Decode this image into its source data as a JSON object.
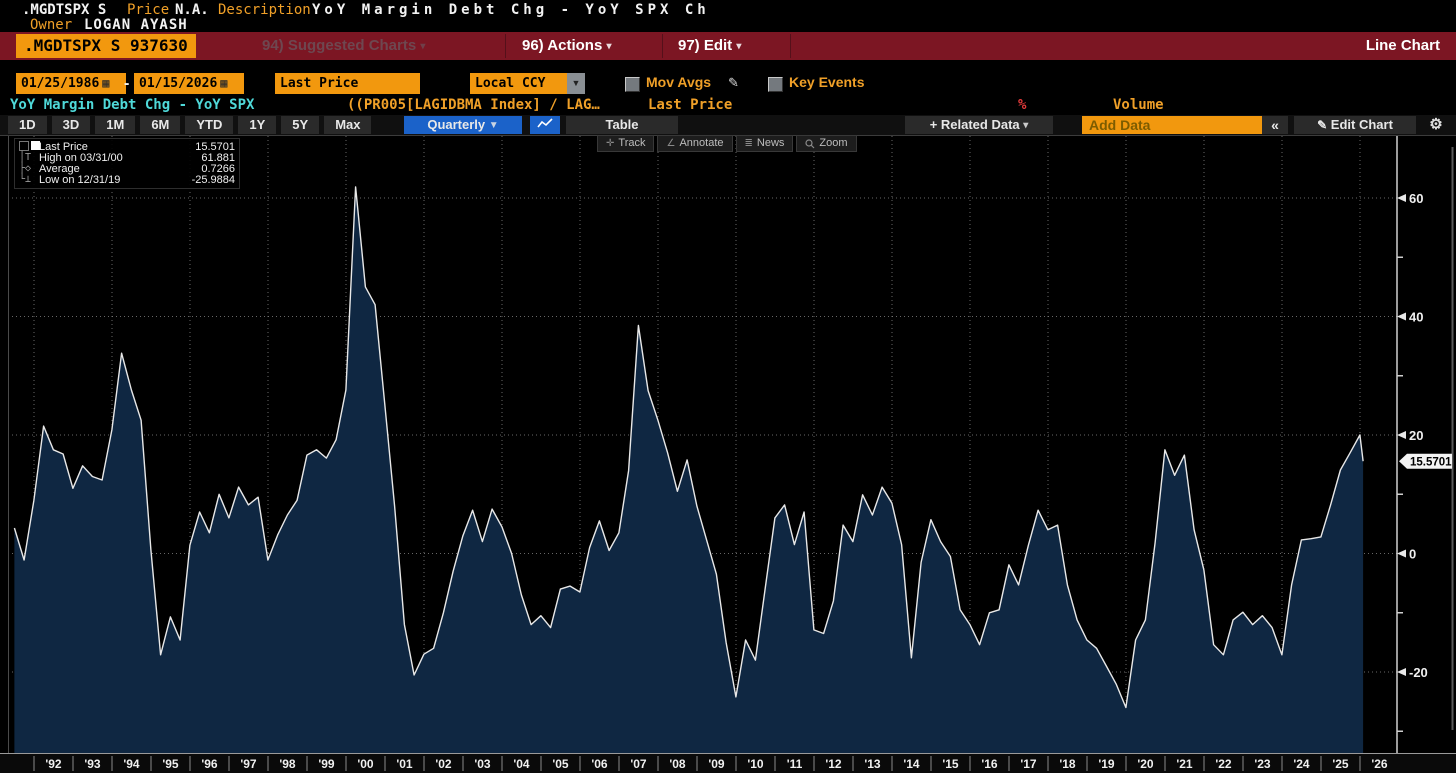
{
  "titlebar": {
    "ticker": ".MGDTSPX S",
    "price_label": "Price",
    "price_value": "N.A.",
    "description_label": "Description",
    "description_value": "YoY Margin Debt Chg - YoY SPX Ch",
    "owner_label": "Owner",
    "owner_value": "LOGAN AYASH"
  },
  "ribbon": {
    "security": ".MGDTSPX S 937630",
    "suggested_charts": "94) Suggested Charts",
    "actions": "96) Actions",
    "edit": "97) Edit",
    "mode": "Line Chart"
  },
  "controls": {
    "date_from": "01/25/1986",
    "date_separator": "-",
    "date_to": "01/15/2026",
    "field": "Last Price",
    "currency": "Local CCY",
    "mov_avgs": "Mov Avgs",
    "key_events": "Key Events"
  },
  "subtitle": {
    "series_name": "YoY Margin Debt Chg - YoY SPX",
    "formula": "((PR005[LAGIDBMA Index] / LAG…",
    "field": "Last Price",
    "percent": "%",
    "volume": "Volume"
  },
  "toolbar": {
    "ranges": [
      "1D",
      "3D",
      "1M",
      "6M",
      "YTD",
      "1Y",
      "5Y",
      "Max"
    ],
    "period": "Quarterly",
    "table": "Table",
    "related_data": "+ Related Data",
    "add_data_placeholder": "Add Data",
    "edit_chart": "Edit Chart"
  },
  "chart_tools": {
    "track": "Track",
    "annotate": "Annotate",
    "news": "News",
    "zoom": "Zoom"
  },
  "legend": {
    "rows": [
      {
        "label": "Last Price",
        "value": "15.5701"
      },
      {
        "label": "High on 03/31/00",
        "value": "61.881"
      },
      {
        "label": "Average",
        "value": "0.7266"
      },
      {
        "label": "Low on 12/31/19",
        "value": "-25.9884"
      }
    ]
  },
  "last_price_marker": "15.5701",
  "colors": {
    "amber": "#f2980e",
    "ribbon_red": "#7c1623",
    "blue": "#1b62c9",
    "cyan": "#4fd9d9",
    "area_fill": "#0f2742",
    "line": "#e8e8e8",
    "grid": "#8a8a8a",
    "percent_red": "#e33a3a"
  },
  "chart_data": {
    "type": "area",
    "title": "YoY Margin Debt Chg - YoY SPX  Last Price",
    "frequency": "Quarterly",
    "y_ticks": [
      60,
      40,
      20,
      0,
      -20
    ],
    "ylim": [
      -32,
      66
    ],
    "x_years": [
      "'92",
      "'93",
      "'94",
      "'95",
      "'96",
      "'97",
      "'98",
      "'99",
      "'00",
      "'01",
      "'02",
      "'03",
      "'04",
      "'05",
      "'06",
      "'07",
      "'08",
      "'09",
      "'10",
      "'11",
      "'12",
      "'13",
      "'14",
      "'15",
      "'16",
      "'17",
      "'18",
      "'19",
      "'20",
      "'21",
      "'22",
      "'23",
      "'24",
      "'25",
      "'26"
    ],
    "stats": {
      "last": 15.5701,
      "high": 61.881,
      "high_date": "03/31/00",
      "average": 0.7266,
      "low": -25.9884,
      "low_date": "12/31/19"
    },
    "dates": [
      "1991-06",
      "1991-09",
      "1991-12",
      "1992-03",
      "1992-06",
      "1992-09",
      "1992-12",
      "1993-03",
      "1993-06",
      "1993-09",
      "1993-12",
      "1994-03",
      "1994-06",
      "1994-09",
      "1994-12",
      "1995-03",
      "1995-06",
      "1995-09",
      "1995-12",
      "1996-03",
      "1996-06",
      "1996-09",
      "1996-12",
      "1997-03",
      "1997-06",
      "1997-09",
      "1997-12",
      "1998-03",
      "1998-06",
      "1998-09",
      "1998-12",
      "1999-03",
      "1999-06",
      "1999-09",
      "1999-12",
      "2000-03",
      "2000-06",
      "2000-09",
      "2000-12",
      "2001-03",
      "2001-06",
      "2001-09",
      "2001-12",
      "2002-03",
      "2002-06",
      "2002-09",
      "2002-12",
      "2003-03",
      "2003-06",
      "2003-09",
      "2003-12",
      "2004-03",
      "2004-06",
      "2004-09",
      "2004-12",
      "2005-03",
      "2005-06",
      "2005-09",
      "2005-12",
      "2006-03",
      "2006-06",
      "2006-09",
      "2006-12",
      "2007-03",
      "2007-06",
      "2007-09",
      "2007-12",
      "2008-03",
      "2008-06",
      "2008-09",
      "2008-12",
      "2009-03",
      "2009-06",
      "2009-09",
      "2009-12",
      "2010-03",
      "2010-06",
      "2010-09",
      "2010-12",
      "2011-03",
      "2011-06",
      "2011-09",
      "2011-12",
      "2012-03",
      "2012-06",
      "2012-09",
      "2012-12",
      "2013-03",
      "2013-06",
      "2013-09",
      "2013-12",
      "2014-03",
      "2014-06",
      "2014-09",
      "2014-12",
      "2015-03",
      "2015-06",
      "2015-09",
      "2015-12",
      "2016-03",
      "2016-06",
      "2016-09",
      "2016-12",
      "2017-03",
      "2017-06",
      "2017-09",
      "2017-12",
      "2018-03",
      "2018-06",
      "2018-09",
      "2018-12",
      "2019-03",
      "2019-06",
      "2019-09",
      "2019-12",
      "2020-03",
      "2020-06",
      "2020-09",
      "2020-12",
      "2021-03",
      "2021-06",
      "2021-09",
      "2021-12",
      "2022-03",
      "2022-06",
      "2022-09",
      "2022-12",
      "2023-03",
      "2023-06",
      "2023-09",
      "2023-12",
      "2024-03",
      "2024-06",
      "2024-09",
      "2024-12",
      "2025-03",
      "2025-06",
      "2025-09",
      "2025-12",
      "2026-01"
    ],
    "values": [
      4.3,
      -1.1,
      9.0,
      21.5,
      17.5,
      16.8,
      11.0,
      14.8,
      13.0,
      12.4,
      20.9,
      33.8,
      27.6,
      22.5,
      0.6,
      -17.1,
      -10.7,
      -14.6,
      1.4,
      7.0,
      3.5,
      10.0,
      6.0,
      11.2,
      8.2,
      9.5,
      -1.1,
      3.1,
      6.5,
      9.0,
      16.6,
      17.5,
      16.1,
      19.2,
      27.6,
      61.881,
      45.0,
      42.0,
      25.0,
      8.0,
      -12.0,
      -20.5,
      -17.0,
      -16.0,
      -10.0,
      -3.0,
      3.0,
      7.3,
      2.0,
      7.5,
      4.5,
      0.0,
      -7.0,
      -12.0,
      -10.5,
      -12.5,
      -6.0,
      -5.5,
      -6.5,
      1.0,
      5.5,
      0.5,
      3.5,
      14.0,
      38.5,
      27.5,
      22.5,
      17.0,
      10.5,
      15.8,
      8.0,
      2.3,
      -3.5,
      -15.0,
      -24.2,
      -14.6,
      -18.0,
      -6.0,
      6.0,
      8.2,
      1.5,
      7.0,
      -12.9,
      -13.5,
      -8.0,
      4.8,
      2.0,
      9.9,
      6.5,
      11.2,
      8.5,
      1.5,
      -17.6,
      -1.5,
      5.7,
      2.0,
      -0.5,
      -9.5,
      -12.0,
      -15.4,
      -10.0,
      -9.5,
      -1.9,
      -5.3,
      1.4,
      7.3,
      4.0,
      4.8,
      -5.3,
      -11.2,
      -14.6,
      -16.0,
      -19.0,
      -22.0,
      -25.9884,
      -14.6,
      -11.2,
      1.8,
      17.5,
      13.2,
      16.6,
      4.0,
      -2.8,
      -15.4,
      -17.1,
      -11.2,
      -9.9,
      -12.0,
      -10.5,
      -12.5,
      -17.1,
      -5.3,
      2.3,
      2.5,
      2.8,
      8.2,
      14.1,
      17.0,
      20.0,
      15.5701
    ]
  }
}
